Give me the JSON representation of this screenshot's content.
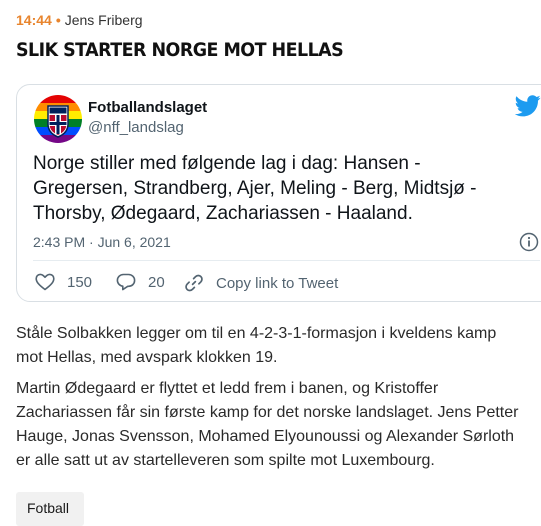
{
  "article": {
    "time": "14:44",
    "author": "Jens Friberg",
    "headline": "SLIK STARTER NORGE MOT HELLAS",
    "paragraphs": [
      "Ståle Solbakken legger om til en 4-2-3-1-formasjon i kveldens kamp\nmot Hellas, med avspark klokken 19.",
      "Martin Ødegaard er flyttet et ledd frem i banen, og Kristoffer\nZachariassen får sin første kamp for det norske landslaget. Jens Petter\nHauge, Jonas Svensson, Mohamed Elyounoussi og Alexander Sørloth\ner alle satt ut av startelleveren som spilte mot Luxembourg."
    ],
    "tag": "Fotball"
  },
  "tweet": {
    "account_name": "Fotballandslaget",
    "handle": "@nff_landslag",
    "text": "Norge stiller med følgende lag i dag: Hansen -\nGregersen, Strandberg, Ajer, Meling - Berg, Midtsjø -\nThorsby, Ødegaard, Zachariassen - Haaland.",
    "date": "2:43 PM · Jun 6, 2021",
    "likes": "150",
    "replies": "20",
    "copy_link": "Copy link to Tweet",
    "icons": {
      "bird": "twitter-bird-icon",
      "info": "info-icon",
      "heart": "heart-icon",
      "reply": "reply-icon",
      "link": "link-icon"
    },
    "colors": {
      "twitter_blue": "#1d9bf0",
      "muted": "#536471"
    }
  },
  "colors": {
    "accent": "#e8852e"
  }
}
